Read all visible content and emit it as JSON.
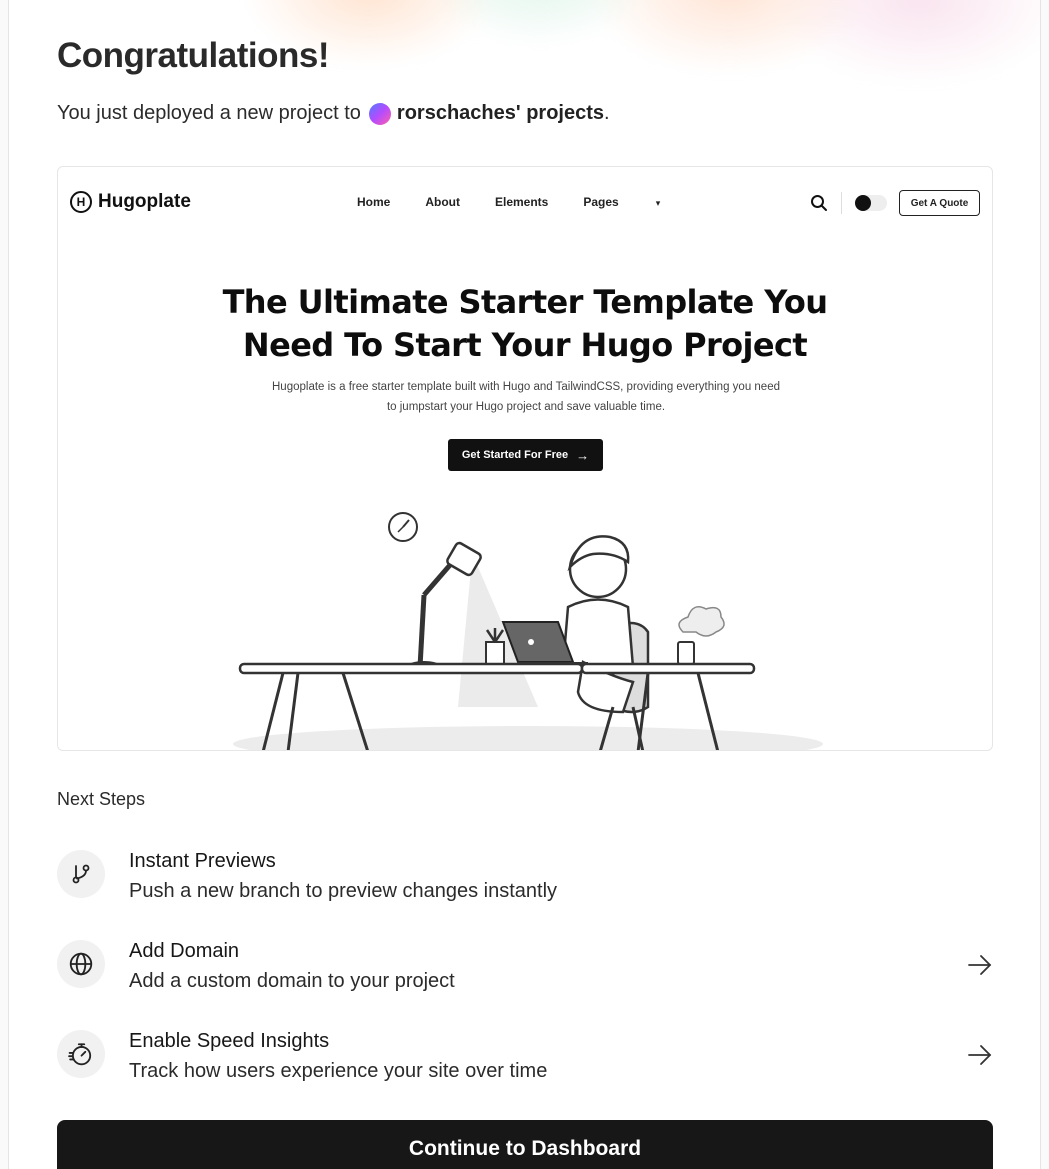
{
  "header": {
    "title": "Congratulations!",
    "subtitle_prefix": "You just deployed a new project to",
    "team_name": "rorschaches' projects",
    "subtitle_suffix": "."
  },
  "preview": {
    "logo_mark": "H",
    "logo_text": "Hugoplate",
    "nav": [
      "Home",
      "About",
      "Elements",
      "Pages"
    ],
    "quote_button": "Get A Quote",
    "hero_title_line1": "The Ultimate Starter Template You",
    "hero_title_line2": "Need To Start Your Hugo Project",
    "hero_desc_line1": "Hugoplate is a free starter template built with Hugo and TailwindCSS, providing everything you need",
    "hero_desc_line2": "to jumpstart your Hugo project and save valuable time.",
    "cta": "Get Started For Free"
  },
  "next_steps": {
    "heading": "Next Steps",
    "items": [
      {
        "title": "Instant Previews",
        "desc": "Push a new branch to preview changes instantly",
        "icon": "git-branch-icon"
      },
      {
        "title": "Add Domain",
        "desc": "Add a custom domain to your project",
        "icon": "globe-icon"
      },
      {
        "title": "Enable Speed Insights",
        "desc": "Track how users experience your site over time",
        "icon": "stopwatch-icon"
      }
    ]
  },
  "continue_button": "Continue to Dashboard",
  "colors": {
    "accent": "#171717",
    "background": "#ffffff",
    "muted": "#f1f1f1"
  }
}
